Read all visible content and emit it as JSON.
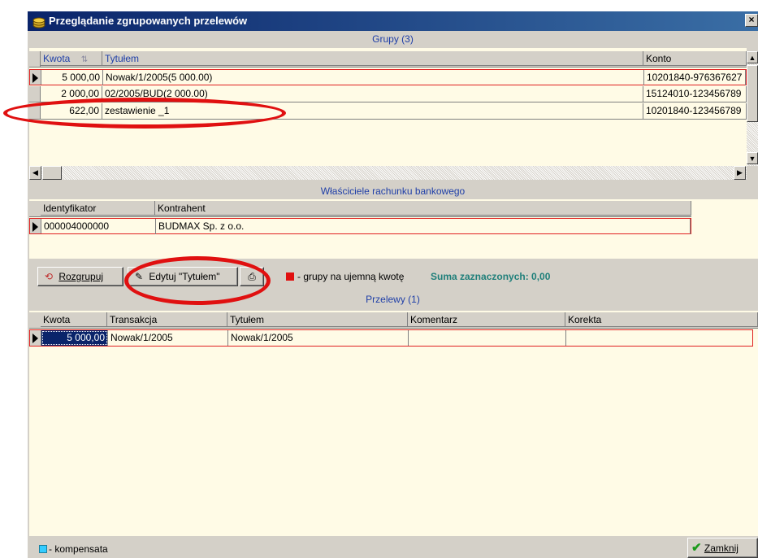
{
  "window": {
    "title": "Przeglądanie zgrupowanych przelewów",
    "close": "×"
  },
  "groups": {
    "title": "Grupy (3)",
    "columns": [
      "Kwota",
      "Tytułem",
      "Konto"
    ],
    "rows": [
      {
        "kwota": "5 000,00",
        "tytulem": "Nowak/1/2005(5 000.00)",
        "konto": "10201840-976367627"
      },
      {
        "kwota": "2 000,00",
        "tytulem": "02/2005/BUD(2 000.00)",
        "konto": "15124010-123456789"
      },
      {
        "kwota": "622,00",
        "tytulem": "zestawienie _1",
        "konto": "10201840-123456789"
      }
    ]
  },
  "owners": {
    "title": "Właściciele rachunku bankowego",
    "columns": [
      "Identyfikator",
      "Kontrahent"
    ],
    "rows": [
      {
        "id": "000004000000",
        "kontrahent": "BUDMAX Sp. z o.o."
      }
    ]
  },
  "toolbar": {
    "ungroup_label": "Rozgrupuj",
    "edit_label": "Edytuj \"Tytułem\"",
    "legend_negative": "- grupy na ujemną kwotę",
    "sum_label": "Suma zaznaczonych: 0,00",
    "negative_color": "#e01010"
  },
  "transfers": {
    "title": "Przelewy (1)",
    "columns": [
      "Kwota",
      "Transakcja",
      "Tytułem",
      "Komentarz",
      "Korekta"
    ],
    "rows": [
      {
        "kwota": "5 000,00",
        "transakcja": "Nowak/1/2005",
        "tytulem": "Nowak/1/2005",
        "komentarz": "",
        "korekta": ""
      }
    ]
  },
  "footer": {
    "legend_compensation": "- kompensata",
    "compensation_color": "#33ccff",
    "close_label": "Zamknij"
  }
}
